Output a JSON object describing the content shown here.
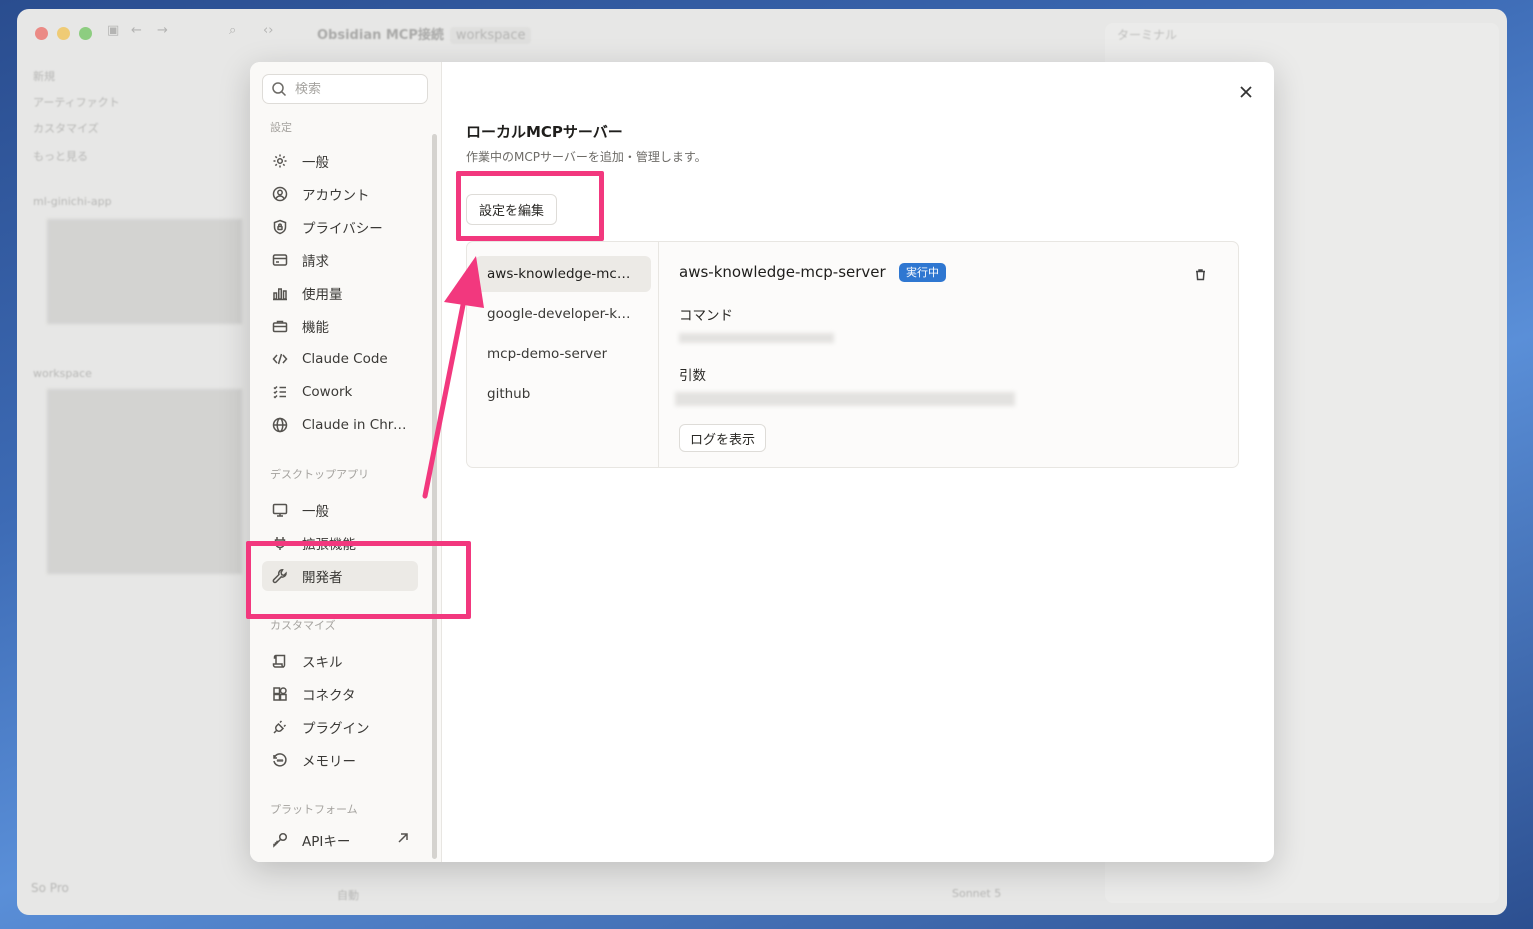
{
  "background_window": {
    "title": "Obsidian MCP接続",
    "title_tag": "workspace",
    "terminal_label": "ターミナル",
    "sidebar_items": [
      "新規",
      "アーティファクト",
      "カスタマイズ",
      "もっと見る"
    ],
    "project_label": "ml-ginichi-app",
    "workspace_label": "workspace",
    "bottom_user": "So",
    "bottom_plan": "Pro",
    "bottom_mode": "自動",
    "bottom_model": "Sonnet 5"
  },
  "settings": {
    "search": {
      "placeholder": "検索"
    },
    "sections": {
      "settings": "設定",
      "desktop": "デスクトップアプリ",
      "customize": "カスタマイズ",
      "platform": "プラットフォーム"
    },
    "nav": {
      "general": "一般",
      "account": "アカウント",
      "privacy": "プライバシー",
      "billing": "請求",
      "usage": "使用量",
      "features": "機能",
      "claude_code": "Claude Code",
      "cowork": "Cowork",
      "claude_in_chrome": "Claude in Chrome",
      "desktop_general": "一般",
      "extensions": "拡張機能",
      "developer": "開発者",
      "skills": "スキル",
      "connectors": "コネクタ",
      "plugins": "プラグイン",
      "memory": "メモリー",
      "api_keys": "APIキー"
    },
    "main": {
      "title": "ローカルMCPサーバー",
      "description": "作業中のMCPサーバーを追加・管理します。",
      "edit_config_label": "設定を編集",
      "servers": [
        "aws-knowledge-mcp-server",
        "google-developer-knowledge",
        "mcp-demo-server",
        "github"
      ],
      "selected_server": {
        "name": "aws-knowledge-mcp-server",
        "status": "実行中",
        "command_label": "コマンド",
        "args_label": "引数",
        "view_logs_label": "ログを表示"
      }
    }
  },
  "colors": {
    "accent_blue": "#2f77d1",
    "annotation_pink": "#f2387e"
  },
  "icons": {
    "close": "close-icon",
    "search": "search-icon",
    "trash": "trash-icon"
  }
}
